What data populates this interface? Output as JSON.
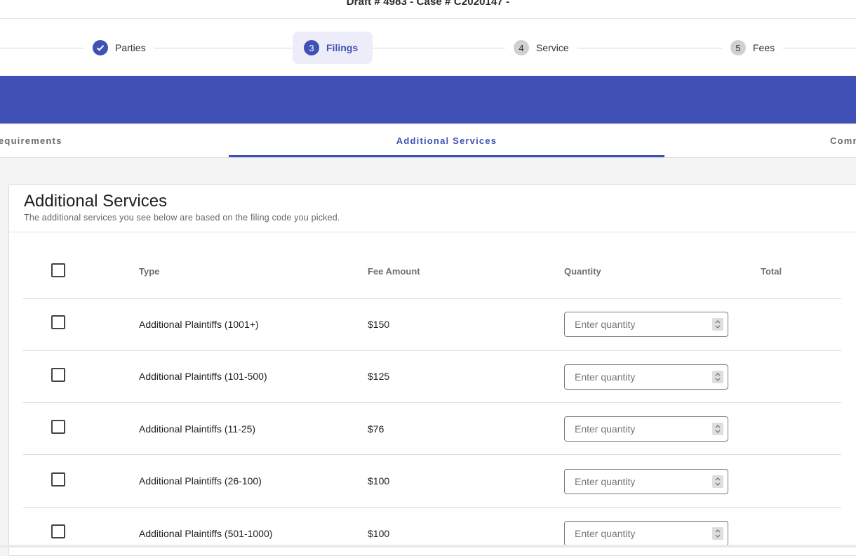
{
  "header": {
    "title": "Draft # 4983 - Case # C2020147 - "
  },
  "stepper": {
    "steps": [
      {
        "label": "Parties",
        "number": "",
        "state": "done"
      },
      {
        "label": "Filings",
        "number": "3",
        "state": "active"
      },
      {
        "label": "Service",
        "number": "4",
        "state": "idle"
      },
      {
        "label": "Fees",
        "number": "5",
        "state": "idle"
      }
    ]
  },
  "subtabs": {
    "left": "equirements",
    "active": "Additional Services",
    "right": "Comm"
  },
  "card": {
    "title": "Additional Services",
    "subtitle": "The additional services you see below are based on the filing code you picked."
  },
  "table": {
    "headers": {
      "type": "Type",
      "fee": "Fee Amount",
      "quantity": "Quantity",
      "total": "Total"
    },
    "rows": [
      {
        "type": "Additional Plaintiffs (1001+)",
        "fee": "$150",
        "quantity_placeholder": "Enter quantity"
      },
      {
        "type": "Additional Plaintiffs (101-500)",
        "fee": "$125",
        "quantity_placeholder": "Enter quantity"
      },
      {
        "type": "Additional Plaintiffs (11-25)",
        "fee": "$76",
        "quantity_placeholder": "Enter quantity"
      },
      {
        "type": "Additional Plaintiffs (26-100)",
        "fee": "$100",
        "quantity_placeholder": "Enter quantity"
      },
      {
        "type": "Additional Plaintiffs (501-1000)",
        "fee": "$100",
        "quantity_placeholder": "Enter quantity"
      }
    ]
  },
  "colors": {
    "accent": "#3f51b5",
    "active_step_bg": "#ecedf9",
    "idle_badge": "#d0d0d0"
  },
  "icons": {
    "done_step": "check-icon",
    "spinner": "chevron-up-down-icon"
  }
}
